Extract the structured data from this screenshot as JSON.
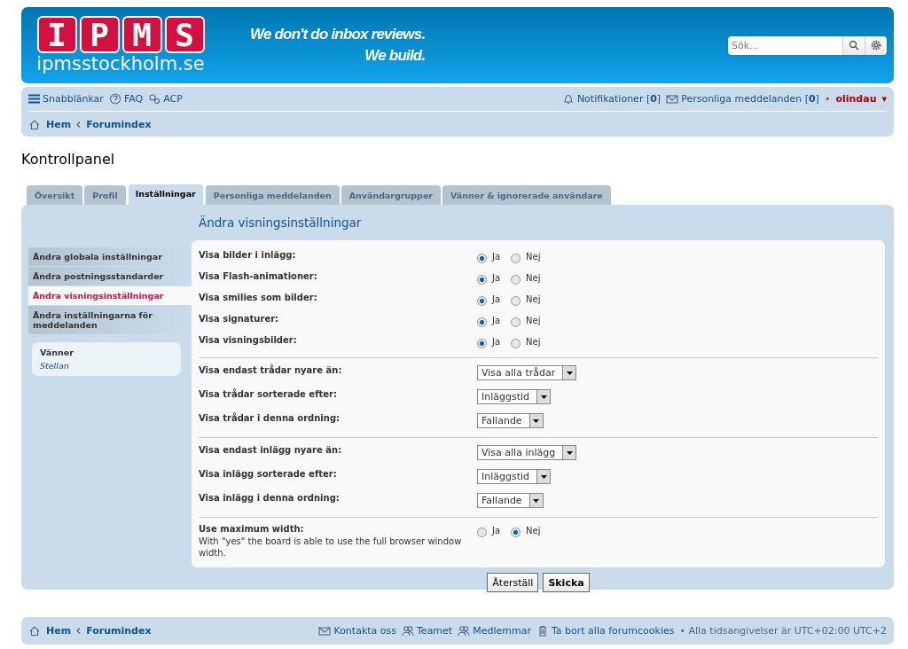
{
  "header": {
    "logo_letters": [
      "I",
      "P",
      "M",
      "S"
    ],
    "logo_domain": "ipmsstockholm.se",
    "slogan": [
      "We don't do inbox reviews.",
      "We build."
    ],
    "search": {
      "placeholder": "Sök..."
    }
  },
  "navbar": {
    "quick_links": "Snabblänkar",
    "faq": "FAQ",
    "acp": "ACP",
    "notifications": "Notifikationer [**0**]",
    "messages": "Personliga meddelanden [**0**]",
    "separator": "•",
    "user": "olindau",
    "user_caret": "▾"
  },
  "breadcrumbs": [
    "Hem",
    "Forumindex"
  ],
  "page_title": "Kontrollpanel",
  "tabs": [
    {
      "label": "Översikt",
      "selected": false
    },
    {
      "label": "Profil",
      "selected": false
    },
    {
      "label": "Inställningar",
      "selected": true
    },
    {
      "label": "Personliga meddelanden",
      "selected": false
    },
    {
      "label": "Användargrupper",
      "selected": false
    },
    {
      "label": "Vänner & ignorerade användare",
      "selected": false
    }
  ],
  "sidebar": {
    "items": [
      {
        "label": "Ändra globala inställningar",
        "selected": false
      },
      {
        "label": "Ändra postningsstandarder",
        "selected": false
      },
      {
        "label": "Ändra visningsinställningar",
        "selected": true
      },
      {
        "label": "Ändra inställningarna för meddelanden",
        "selected": false
      }
    ],
    "friends": {
      "title": "Vänner",
      "names": [
        "Stellan"
      ]
    }
  },
  "panel_title": "Ändra visningsinställningar",
  "sections": [
    {
      "rows": [
        {
          "kind": "radio",
          "label": "Visa bilder i inlägg:",
          "options": [
            {
              "label": "Ja",
              "selected": true
            },
            {
              "label": "Nej",
              "selected": false
            }
          ]
        },
        {
          "kind": "radio",
          "label": "Visa Flash-animationer:",
          "options": [
            {
              "label": "Ja",
              "selected": true
            },
            {
              "label": "Nej",
              "selected": false
            }
          ]
        },
        {
          "kind": "radio",
          "label": "Visa smilies som bilder:",
          "options": [
            {
              "label": "Ja",
              "selected": true
            },
            {
              "label": "Nej",
              "selected": false
            }
          ]
        },
        {
          "kind": "radio",
          "label": "Visa signaturer:",
          "options": [
            {
              "label": "Ja",
              "selected": true
            },
            {
              "label": "Nej",
              "selected": false
            }
          ]
        },
        {
          "kind": "radio",
          "label": "Visa visningsbilder:",
          "options": [
            {
              "label": "Ja",
              "selected": true
            },
            {
              "label": "Nej",
              "selected": false
            }
          ]
        }
      ]
    },
    {
      "rows": [
        {
          "kind": "select",
          "label": "Visa endast trådar nyare än:",
          "value": "Visa alla trådar"
        },
        {
          "kind": "select",
          "label": "Visa trådar sorterade efter:",
          "value": "Inläggstid"
        },
        {
          "kind": "select",
          "label": "Visa trådar i denna ordning:",
          "value": "Fallande"
        }
      ]
    },
    {
      "rows": [
        {
          "kind": "select",
          "label": "Visa endast inlägg nyare än:",
          "value": "Visa alla inlägg"
        },
        {
          "kind": "select",
          "label": "Visa inlägg sorterade efter:",
          "value": "Inläggstid"
        },
        {
          "kind": "select",
          "label": "Visa inlägg i denna ordning:",
          "value": "Fallande"
        }
      ]
    },
    {
      "rows": [
        {
          "kind": "radio",
          "label": "Use maximum width:",
          "description": "With \"yes\" the board is able to use the full browser window width.",
          "options": [
            {
              "label": "Ja",
              "selected": false
            },
            {
              "label": "Nej",
              "selected": true
            }
          ]
        }
      ]
    }
  ],
  "buttons": [
    {
      "label": "Återställ",
      "primary": false
    },
    {
      "label": "Skicka",
      "primary": true
    }
  ],
  "footer": {
    "breadcrumbs": [
      "Hem",
      "Forumindex"
    ],
    "links": [
      {
        "kind": "mail",
        "label": "Kontakta oss"
      },
      {
        "kind": "team",
        "label": "Teamet"
      },
      {
        "kind": "team",
        "label": "Medlemmar"
      },
      {
        "kind": "trash",
        "label": "Ta bort alla forumcookies"
      }
    ],
    "timezone": "• Alla tidsangivelser är UTC+02:00 UTC+2"
  }
}
